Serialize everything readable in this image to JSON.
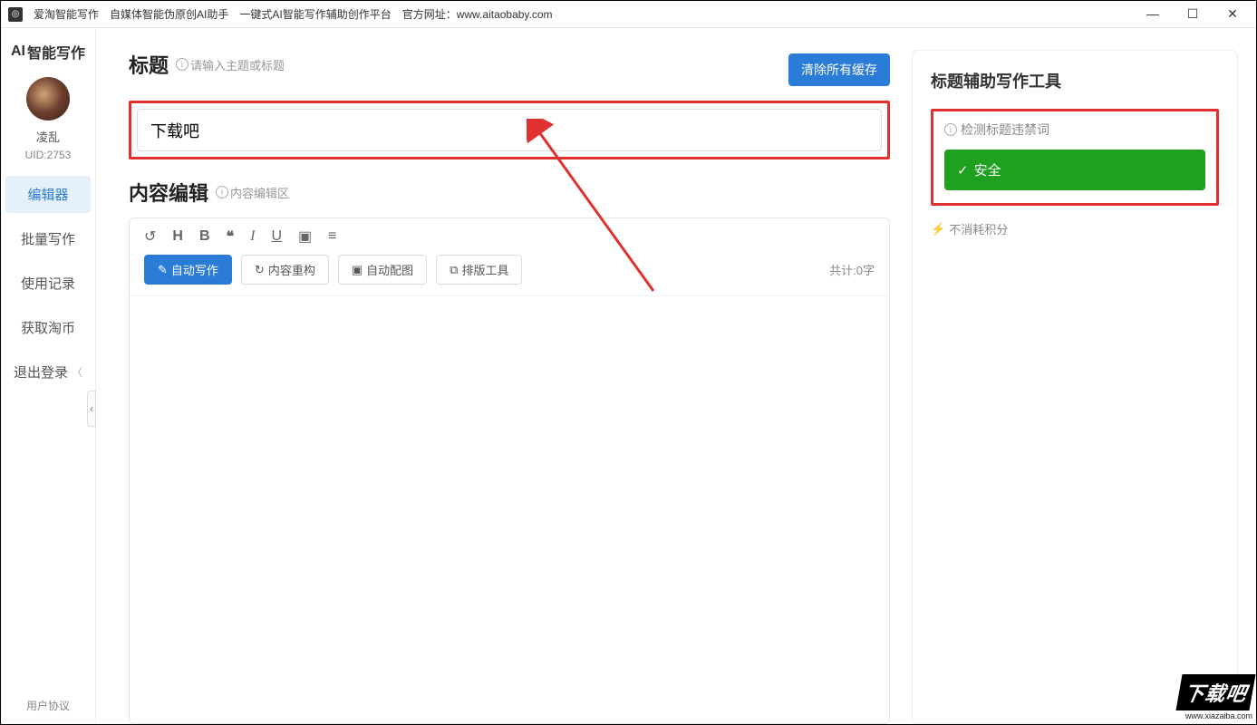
{
  "titlebar": {
    "app_name": "爱淘智能写作",
    "subtitle": "自媒体智能伪原创AI助手　一键式AI智能写作辅助创作平台",
    "official_label": "官方网址：",
    "official_url": "www.aitaobaby.com"
  },
  "sidebar": {
    "logo_text": "智能写作",
    "logo_prefix": "AI",
    "username": "凌乱",
    "uid_label": "UID:2753",
    "items": [
      {
        "label": "编辑器",
        "active": true
      },
      {
        "label": "批量写作",
        "active": false
      },
      {
        "label": "使用记录",
        "active": false
      },
      {
        "label": "获取淘币",
        "active": false
      },
      {
        "label": "退出登录",
        "active": false
      }
    ],
    "footer": "用户协议"
  },
  "main": {
    "title_section": {
      "heading": "标题",
      "hint": "请输入主题或标题",
      "clear_button": "清除所有缓存",
      "input_value": "下载吧"
    },
    "content_section": {
      "heading": "内容编辑",
      "hint": "内容编辑区",
      "buttons": {
        "auto_write": "自动写作",
        "restructure": "内容重构",
        "auto_image": "自动配图",
        "layout_tool": "排版工具"
      },
      "word_count": "共计:0字"
    }
  },
  "right": {
    "heading": "标题辅助写作工具",
    "check_label": "检测标题违禁词",
    "safe_label": "安全",
    "points_note": "不消耗积分"
  },
  "watermark": {
    "text": "下载吧",
    "url": "www.xiazaiba.com"
  }
}
